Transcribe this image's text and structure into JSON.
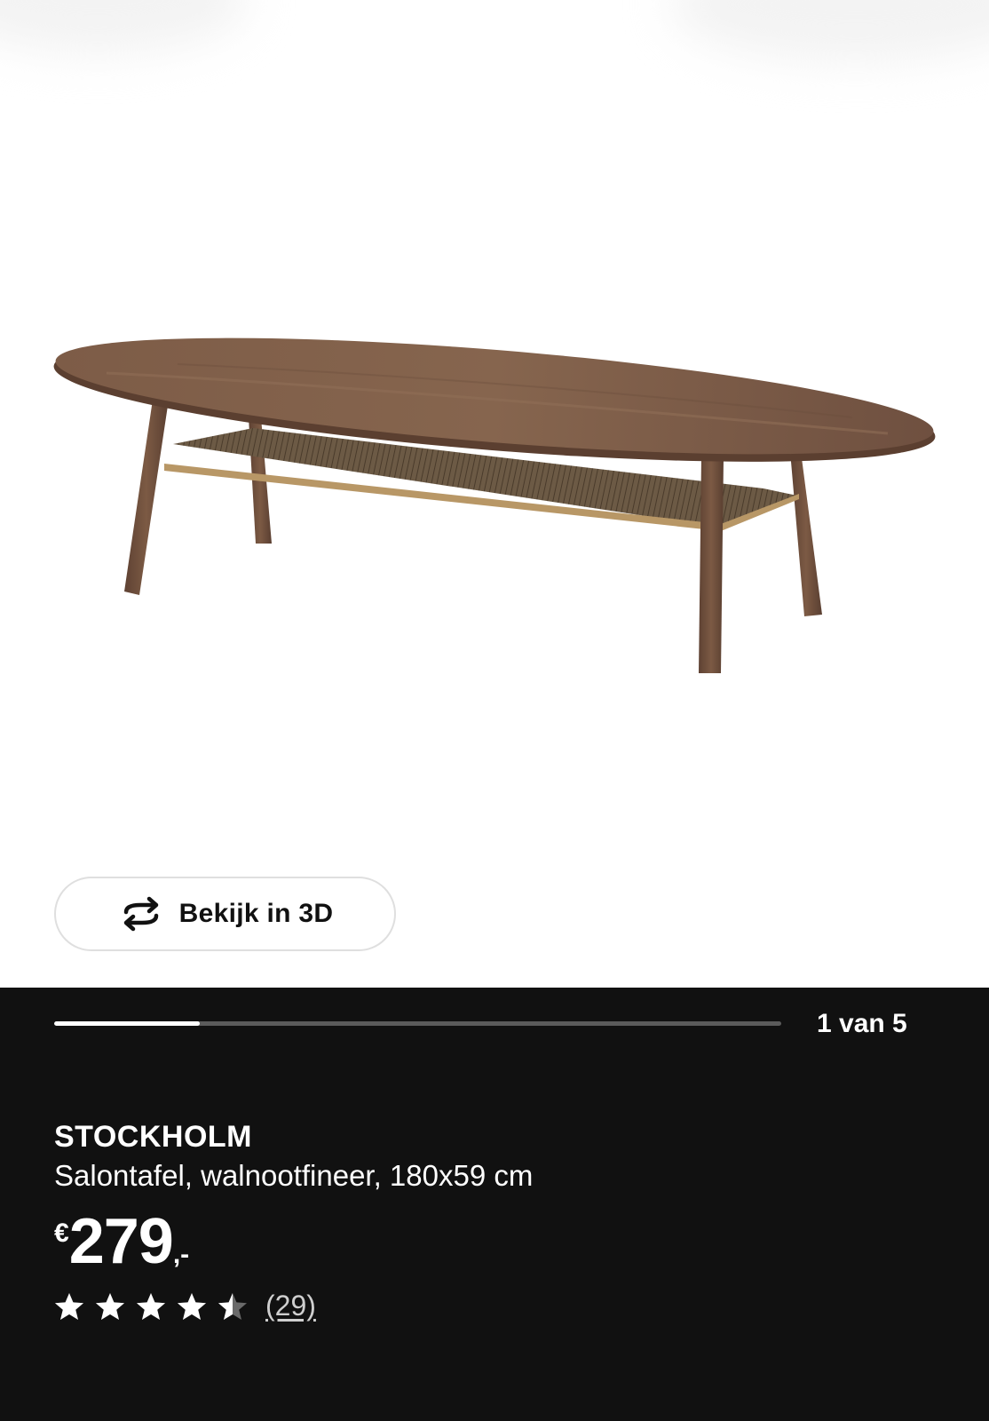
{
  "gallery": {
    "view3d_label": "Bekijk in 3D",
    "image_index": 1,
    "image_total": 5,
    "counter_text": "1 van 5",
    "progress_fraction": 0.2
  },
  "product": {
    "brand": "STOCKHOLM",
    "description": "Salontafel, walnootfineer, 180x59 cm",
    "price": {
      "currency": "€",
      "integer": "279",
      "decimal": ",-"
    },
    "rating": {
      "value": 4.5,
      "max": 5,
      "reviews_text": "(29)"
    }
  },
  "icons": {
    "view3d": "rotate-3d-icon",
    "star": "star-icon"
  },
  "colors": {
    "panel_bg": "#111111",
    "wood": "#7a5a45"
  }
}
